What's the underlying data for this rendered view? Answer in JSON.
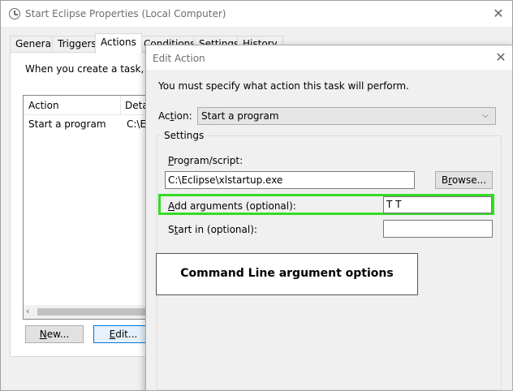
{
  "parent_window": {
    "title": "Start Eclipse Properties (Local Computer)",
    "close_glyph": "✕",
    "tabs": [
      {
        "label": "General"
      },
      {
        "label": "Triggers"
      },
      {
        "label": "Actions"
      },
      {
        "label": "Conditions"
      },
      {
        "label": "Settings"
      },
      {
        "label": "History"
      }
    ],
    "active_tab": "Actions",
    "intro_text": "When you create a task, you",
    "list": {
      "columns": [
        "Action",
        "Deta"
      ],
      "rows": [
        {
          "action": "Start a program",
          "details": "C:\\Ec"
        }
      ],
      "scroll_left_glyph": "‹"
    },
    "buttons": {
      "new_ul": "N",
      "new_rest": "ew...",
      "edit_ul": "E",
      "edit_rest": "dit..."
    }
  },
  "dialog": {
    "title": "Edit Action",
    "close_glyph": "✕",
    "instruction": "You must specify what action this task will perform.",
    "action_label_pre": "Ac",
    "action_label_ul": "t",
    "action_label_post": "ion:",
    "action_value": "Start a program",
    "dropdown_glyph": "⌵",
    "settings_legend": "Settings",
    "program_label_pre": "",
    "program_label_ul": "P",
    "program_label_post": "rogram/script:",
    "program_value": "C:\\Eclipse\\xlstartup.exe",
    "browse_pre": "B",
    "browse_ul": "r",
    "browse_post": "owse...",
    "arguments_label_ul": "A",
    "arguments_label_post": "dd arguments (optional):",
    "arguments_value": "T T",
    "start_in_label_pre": "S",
    "start_in_label_ul": "t",
    "start_in_label_post": "art in (optional):",
    "start_in_value": "",
    "callout_text": "Command Line argument options"
  },
  "colors": {
    "highlight": "#33dd22",
    "focus_border": "#0078d7"
  }
}
